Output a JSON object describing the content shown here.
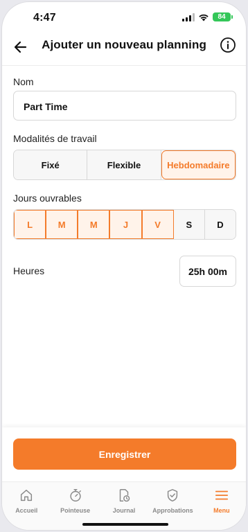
{
  "status": {
    "time": "4:47",
    "battery": "84"
  },
  "header": {
    "title": "Ajouter un nouveau planning"
  },
  "form": {
    "name_label": "Nom",
    "name_value": "Part Time",
    "mode_label": "Modalités de travail",
    "modes": [
      {
        "label": "Fixé",
        "active": false
      },
      {
        "label": "Flexible",
        "active": false
      },
      {
        "label": "Hebdomadaire",
        "active": true
      }
    ],
    "days_label": "Jours ouvrables",
    "days": [
      {
        "label": "L",
        "selected": true
      },
      {
        "label": "M",
        "selected": true
      },
      {
        "label": "M",
        "selected": true
      },
      {
        "label": "J",
        "selected": true
      },
      {
        "label": "V",
        "selected": true
      },
      {
        "label": "S",
        "selected": false
      },
      {
        "label": "D",
        "selected": false
      }
    ],
    "hours_label": "Heures",
    "hours_value": "25h 00m"
  },
  "actions": {
    "save_label": "Enregistrer"
  },
  "tabs": [
    {
      "label": "Accueil",
      "icon": "home-icon",
      "active": false
    },
    {
      "label": "Pointeuse",
      "icon": "stopwatch-icon",
      "active": false
    },
    {
      "label": "Journal",
      "icon": "document-clock-icon",
      "active": false
    },
    {
      "label": "Approbations",
      "icon": "shield-check-icon",
      "active": false
    },
    {
      "label": "Menu",
      "icon": "menu-icon",
      "active": true
    }
  ],
  "colors": {
    "accent": "#f47b2a",
    "accent_bg": "#fff3ea",
    "battery": "#34c759"
  }
}
